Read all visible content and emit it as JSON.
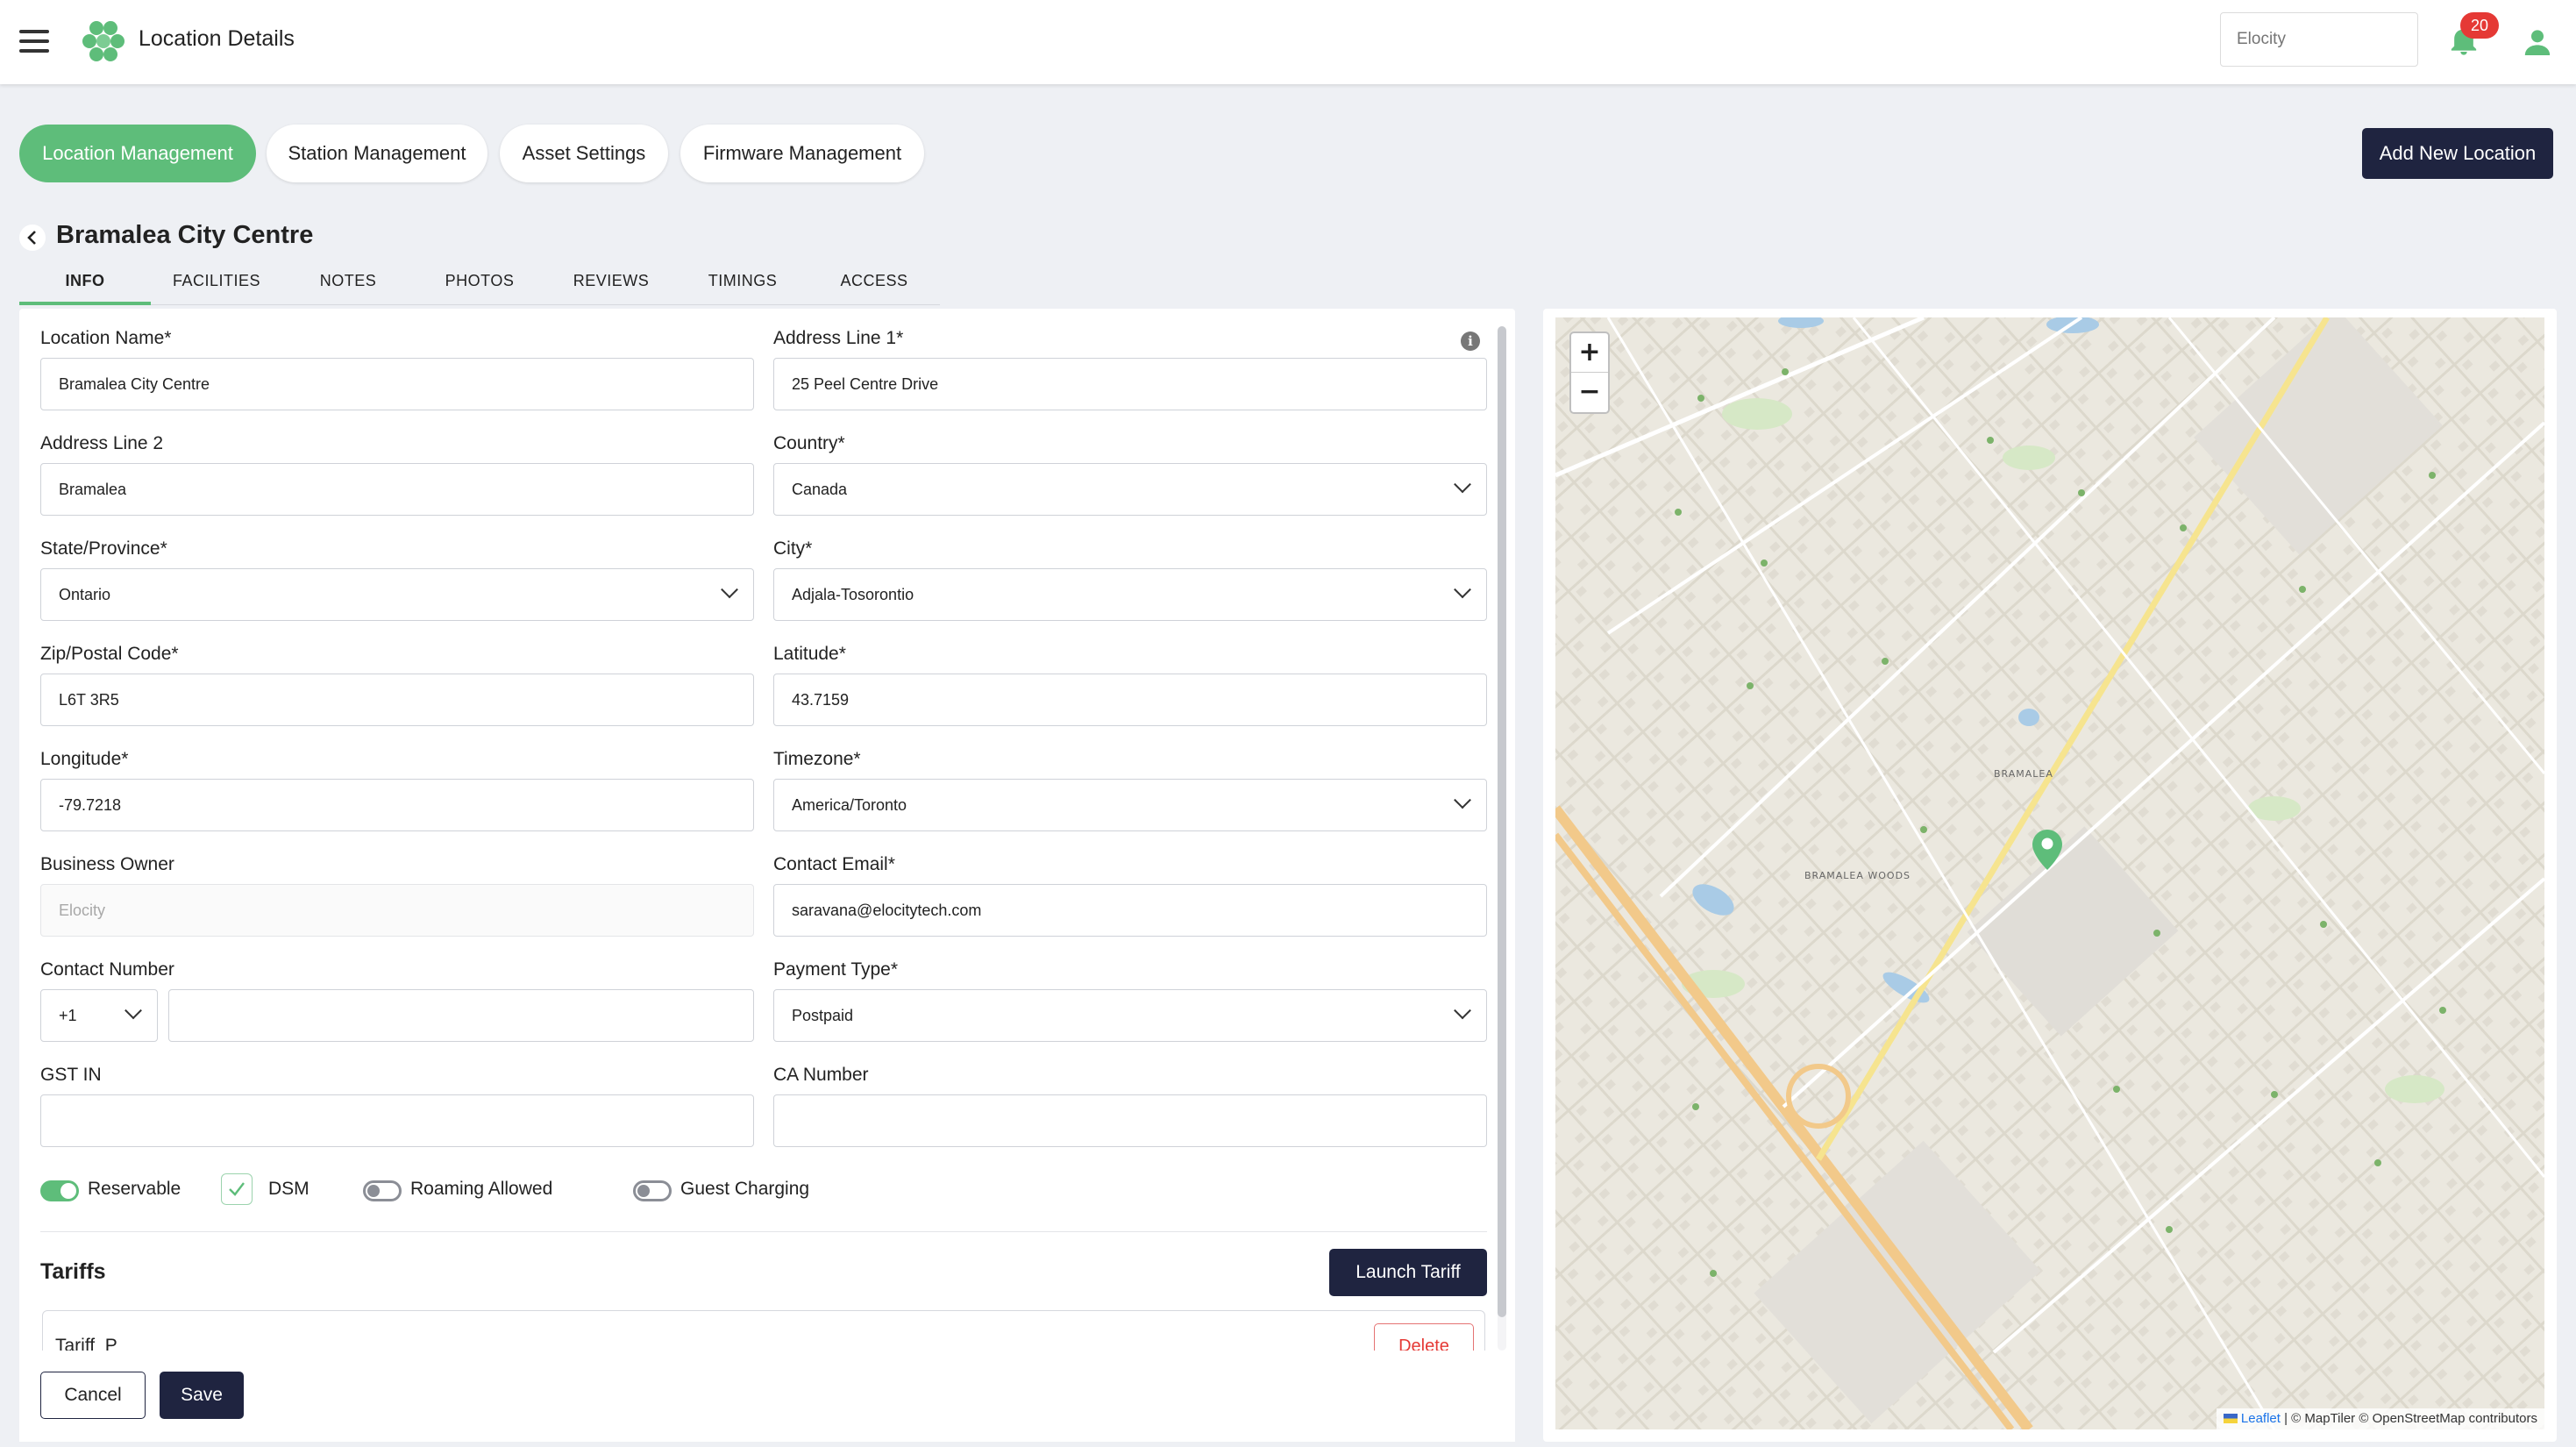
{
  "app": {
    "title": "Location Details",
    "brand_placeholder": "Elocity",
    "notification_count": "20",
    "accent_color": "#5ebd7a",
    "dark_color": "#1f2440"
  },
  "module_tabs": [
    {
      "label": "Location Management",
      "active": true
    },
    {
      "label": "Station Management",
      "active": false
    },
    {
      "label": "Asset Settings",
      "active": false
    },
    {
      "label": "Firmware Management",
      "active": false
    }
  ],
  "add_location_label": "Add New Location",
  "location": {
    "title": "Bramalea City Centre"
  },
  "sub_tabs": [
    {
      "label": "INFO",
      "active": true
    },
    {
      "label": "FACILITIES"
    },
    {
      "label": "NOTES"
    },
    {
      "label": "PHOTOS"
    },
    {
      "label": "REVIEWS"
    },
    {
      "label": "TIMINGS"
    },
    {
      "label": "ACCESS"
    }
  ],
  "form": {
    "location_name": {
      "label": "Location Name*",
      "value": "Bramalea City Centre"
    },
    "address_line_1": {
      "label": "Address Line 1*",
      "value": "25 Peel Centre Drive"
    },
    "address_line_2": {
      "label": "Address Line 2",
      "value": "Bramalea"
    },
    "country": {
      "label": "Country*",
      "value": "Canada"
    },
    "state": {
      "label": "State/Province*",
      "value": "Ontario"
    },
    "city": {
      "label": "City*",
      "value": "Adjala-Tosorontio"
    },
    "zip": {
      "label": "Zip/Postal Code*",
      "value": "L6T 3R5"
    },
    "latitude": {
      "label": "Latitude*",
      "value": "43.7159"
    },
    "longitude": {
      "label": "Longitude*",
      "value": "-79.7218"
    },
    "timezone": {
      "label": "Timezone*",
      "value": "America/Toronto"
    },
    "business_owner": {
      "label": "Business Owner",
      "placeholder": "Elocity"
    },
    "contact_email": {
      "label": "Contact Email*",
      "value": "saravana@elocitytech.com"
    },
    "contact_number": {
      "label": "Contact Number",
      "code": "+1",
      "value": ""
    },
    "payment_type": {
      "label": "Payment Type*",
      "value": "Postpaid"
    },
    "gst_in": {
      "label": "GST IN",
      "value": ""
    },
    "ca_number": {
      "label": "CA Number",
      "value": ""
    }
  },
  "toggles": {
    "reservable": {
      "label": "Reservable",
      "on": true
    },
    "dsm": {
      "label": "DSM",
      "checked": true
    },
    "roaming": {
      "label": "Roaming Allowed",
      "on": false
    },
    "guest": {
      "label": "Guest Charging",
      "on": false
    }
  },
  "tariffs": {
    "title": "Tariffs",
    "launch_label": "Launch Tariff",
    "items": [
      {
        "name": "Tariff_P",
        "delete_label": "Delete"
      }
    ]
  },
  "actions": {
    "cancel_label": "Cancel",
    "save_label": "Save"
  },
  "map": {
    "zoom_in": "+",
    "zoom_out": "−",
    "attribution_leaflet": "Leaflet",
    "attribution_rest": " | © MapTiler © OpenStreetMap contributors",
    "labels": {
      "bramalea": "BRAMALEA",
      "woods": "BRAMALEA WOODS"
    }
  }
}
